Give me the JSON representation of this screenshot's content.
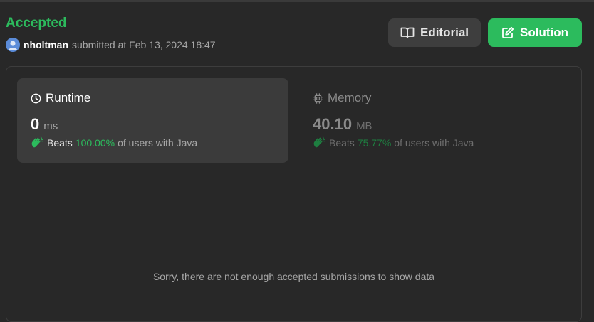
{
  "submission": {
    "status": "Accepted",
    "username": "nholtman",
    "submitted_text": "submitted at Feb 13, 2024 18:47"
  },
  "buttons": {
    "editorial_label": "Editorial",
    "solution_label": "Solution"
  },
  "runtime": {
    "title": "Runtime",
    "value": "0",
    "unit": "ms",
    "beats_label": "Beats",
    "beats_pct": "100.00%",
    "beats_suffix": "of users with Java"
  },
  "memory": {
    "title": "Memory",
    "value": "40.10",
    "unit": "MB",
    "beats_label": "Beats",
    "beats_pct": "75.77%",
    "beats_suffix": "of users with Java"
  },
  "empty_message": "Sorry, there are not enough accepted submissions to show data",
  "icons": {
    "editorial": "book-open-icon",
    "solution": "edit-icon",
    "runtime": "clock-icon",
    "memory": "chip-icon",
    "beats": "clap-icon"
  },
  "colors": {
    "accent": "#2cbb5d",
    "background": "#282828",
    "card": "#3b3b3b"
  }
}
